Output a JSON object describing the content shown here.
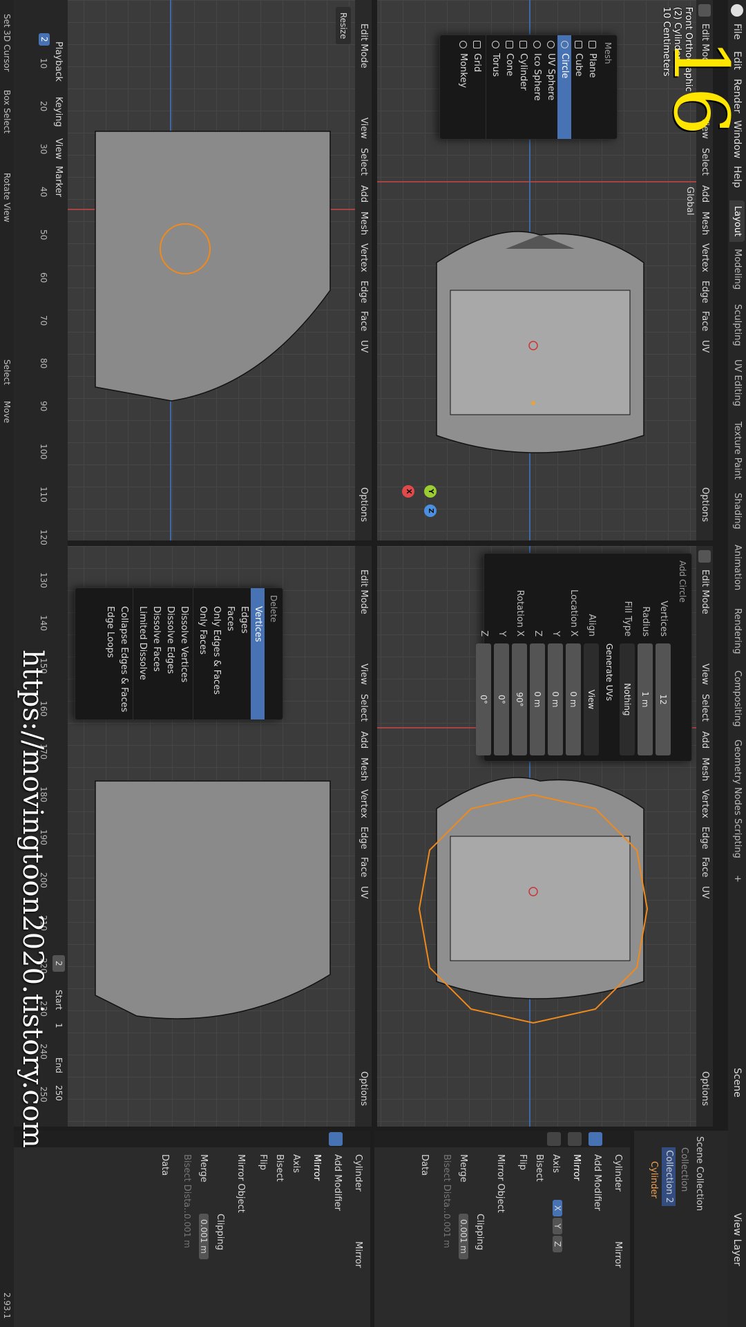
{
  "topbar": {
    "menus": [
      "File",
      "Edit",
      "Render",
      "Window",
      "Help"
    ],
    "workspaces": [
      "Layout",
      "Modeling",
      "Sculpting",
      "UV Editing",
      "Texture Paint",
      "Shading",
      "Animation",
      "Rendering",
      "Compositing",
      "Geometry Nodes",
      "Scripting"
    ],
    "plus": "+",
    "scene_label": "Scene",
    "view_layer_label": "View Layer"
  },
  "viewport_header": {
    "mode": "Edit Mode",
    "menus": [
      "View",
      "Select",
      "Add",
      "Mesh",
      "Vertex",
      "Edge",
      "Face",
      "UV"
    ],
    "orientation": "Global",
    "axes": [
      "X",
      "Y",
      "Z"
    ],
    "options": "Options"
  },
  "viewport_tl": {
    "overlay": [
      "Front Orthographic",
      "(2) Cylinder",
      "10 Centimeters"
    ]
  },
  "add_mesh_menu": {
    "title": "Mesh",
    "items": [
      "Plane",
      "Cube",
      "Circle",
      "UV Sphere",
      "Ico Sphere",
      "Cylinder",
      "Cone",
      "Torus",
      "Grid",
      "Monkey"
    ]
  },
  "add_circle": {
    "title": "Add Circle",
    "rows": [
      {
        "label": "Vertices",
        "value": "12"
      },
      {
        "label": "Radius",
        "value": "1 m"
      },
      {
        "label": "Fill Type",
        "value": "Nothing"
      },
      {
        "label": "",
        "value": "Generate UVs"
      },
      {
        "label": "Align",
        "value": "View"
      },
      {
        "label": "Location X",
        "value": "0 m"
      },
      {
        "label": "Y",
        "value": "0 m"
      },
      {
        "label": "Z",
        "value": "0 m"
      },
      {
        "label": "Rotation X",
        "value": "90°"
      },
      {
        "label": "Y",
        "value": "0°"
      },
      {
        "label": "Z",
        "value": "0°"
      }
    ]
  },
  "delete_menu": {
    "title": "Delete",
    "items": [
      "Vertices",
      "Edges",
      "Faces",
      "Only Edges & Faces",
      "Only Faces",
      "Dissolve Vertices",
      "Dissolve Edges",
      "Dissolve Faces",
      "Limited Dissolve",
      "Collapse Edges & Faces",
      "Edge Loops"
    ]
  },
  "resize_label": "Resize",
  "timeline": {
    "menus": [
      "Playback",
      "Keying",
      "View",
      "Marker"
    ],
    "current": "2",
    "ticks": [
      "10",
      "20",
      "30",
      "40",
      "50",
      "60",
      "70",
      "80",
      "90",
      "100",
      "110",
      "120",
      "130",
      "140",
      "150",
      "160",
      "170",
      "180",
      "190",
      "200",
      "210",
      "220",
      "230",
      "240",
      "250"
    ],
    "frame": "2",
    "start_label": "Start",
    "start": "1",
    "end_label": "End",
    "end": "250"
  },
  "status": {
    "items": [
      "Set 3D Cursor",
      "Box Select",
      "Rotate View",
      "Select",
      "Move"
    ],
    "version": "2.93.1"
  },
  "outliner": {
    "scene_collection": "Scene Collection",
    "collection": "Collection",
    "collection2": "Collection 2",
    "object": "Cylinder"
  },
  "props": {
    "object_name": "Cylinder",
    "modifier_name": "Mirror",
    "add_modifier": "Add Modifier",
    "mod_short": "Mirror",
    "axis_label": "Axis",
    "bisect_label": "Bisect",
    "flip_label": "Flip",
    "axes": [
      "X",
      "Y",
      "Z"
    ],
    "mirror_object_label": "Mirror Object",
    "clipping_label": "Clipping",
    "merge_label": "Merge",
    "merge_value": "0.001 m",
    "bisect_dist_label": "Bisect Dista...",
    "bisect_dist_value": "0.001 m",
    "data_label": "Data"
  },
  "watermark": {
    "number": "16",
    "url": "https://movingtoon2020.tistory.com"
  },
  "colors": {
    "selected": "#4772b3",
    "orange": "#f08a1c",
    "bg": "#3b3b3b"
  }
}
